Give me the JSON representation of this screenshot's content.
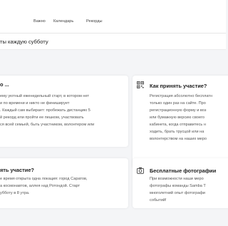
{
  "nav": {
    "items": [
      {
        "label": "Важно"
      },
      {
        "label": "Календарь"
      },
      {
        "label": "Рекорды"
      }
    ]
  },
  "subheader": {
    "text": "ты каждую субботу"
  },
  "sections": {
    "left_top": {
      "title": "о ...",
      "lines": [
        "ему уютный еженедельный старт, в котором нет",
        "и по времени и никто не финиширует",
        ". Каждый сам выбирает: пробежать дистанцию 5",
        "й рекорд или пройти ее пешком, участвовать",
        "ся всей семьей, быть участником, волонтером или"
      ]
    },
    "right_top": {
      "title": "Как принять участие?",
      "lines": [
        "Регистрация абсолютно бесплатн",
        "только один раз на сайте. Про",
        "регистрационную форму и воз",
        "или бумажную версию своего",
        "кабинета, когда отправитесь н",
        "ходить, брать трусцой или на",
        "волонтерством на наших меро"
      ]
    },
    "left_bottom": {
      "title": "ять участие?",
      "lines": [
        "е время открыта одна локация: город Саратов,",
        "а космонавтов, аллея над Ротондой. Старт",
        "убботу в 8 утра."
      ]
    },
    "right_bottom": {
      "title": "Бесплатные фотографии",
      "lines": [
        "При возможности наши меро",
        "фотографы команды Samba T",
        "многолетний опыт фотографи",
        "событий!"
      ]
    }
  },
  "icons": {
    "right_top": "qr-code-icon",
    "right_bottom": "camera-icon"
  },
  "colors": {
    "background": "#f4f5f7",
    "card": "#ffffff",
    "text": "#2b2b2b",
    "muted": "#555555"
  }
}
